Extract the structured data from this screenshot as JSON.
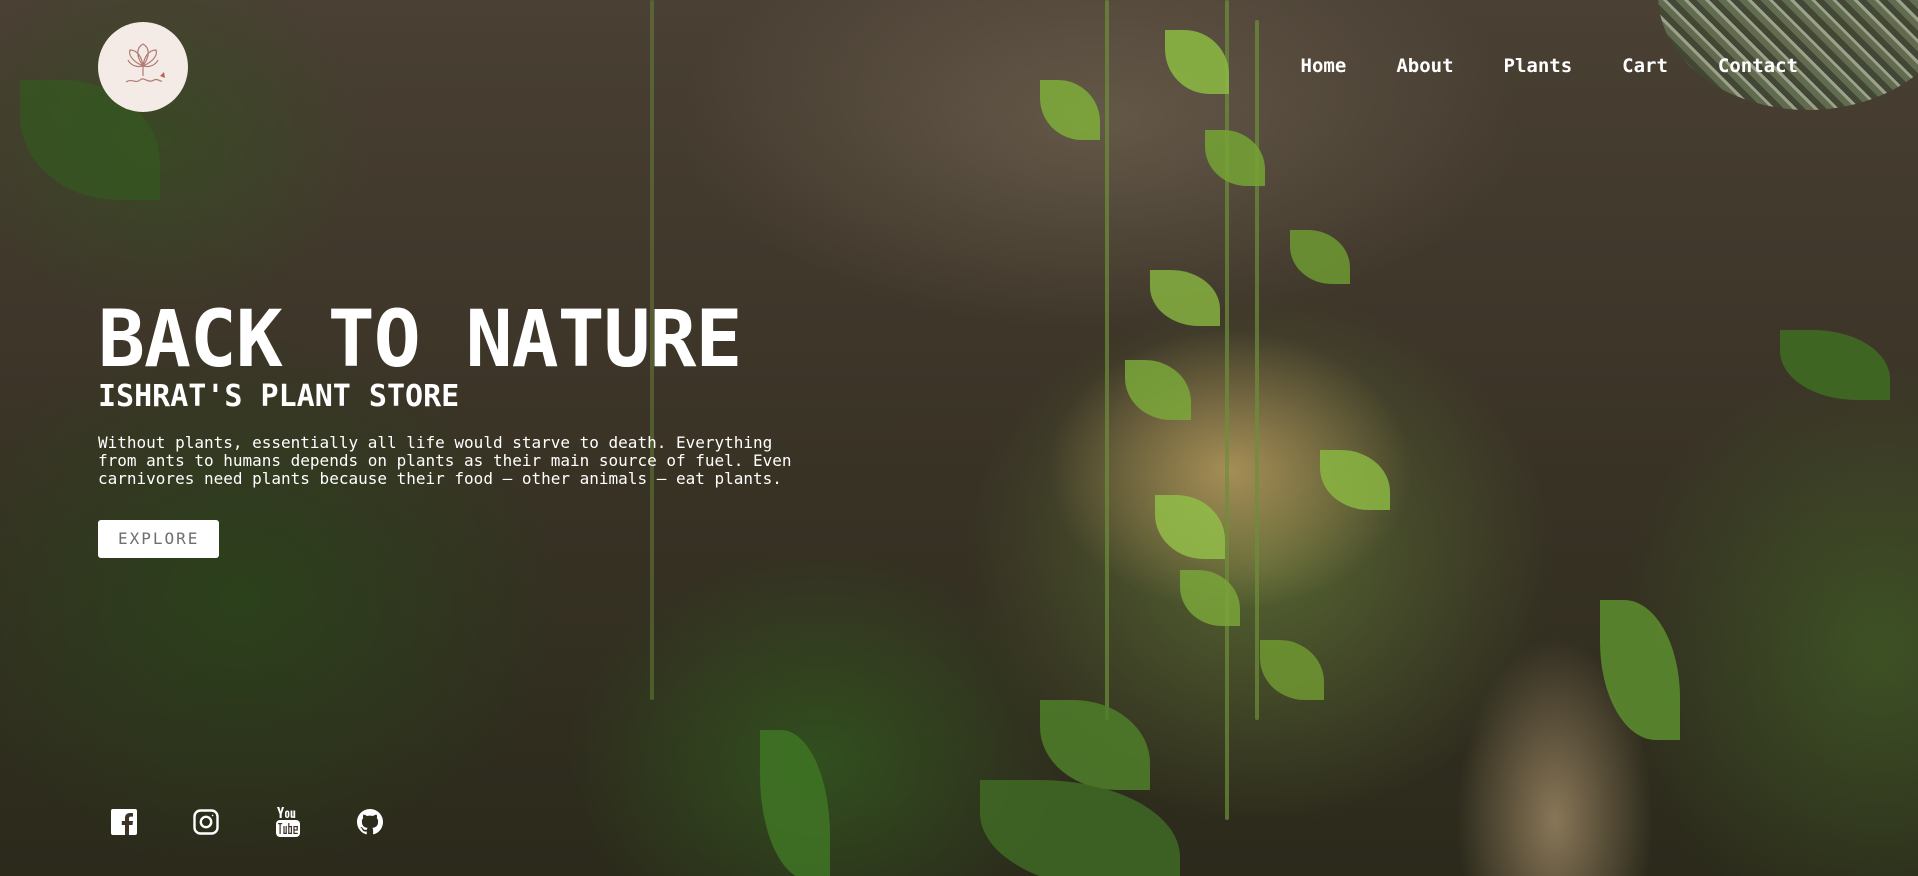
{
  "logo": {
    "alt": "Ishrat's Plant Store logo"
  },
  "nav": {
    "items": [
      {
        "label": "Home"
      },
      {
        "label": "About"
      },
      {
        "label": "Plants"
      },
      {
        "label": "Cart"
      },
      {
        "label": "Contact"
      }
    ]
  },
  "hero": {
    "headline": "BACK TO NATURE",
    "subtitle": "ISHRAT'S PLANT STORE",
    "description": "Without plants, essentially all life would starve to death. Everything from ants to humans depends on plants as their main source of fuel. Even carnivores need plants because their food – other animals – eat plants.",
    "button_label": "EXPLORE"
  },
  "social": {
    "icons": [
      "facebook-icon",
      "instagram-icon",
      "youtube-icon",
      "github-icon"
    ]
  },
  "colors": {
    "text": "#ffffff",
    "button_bg": "#ffffff",
    "button_text": "#6e6e6e",
    "logo_bg": "#f4ebe6"
  }
}
